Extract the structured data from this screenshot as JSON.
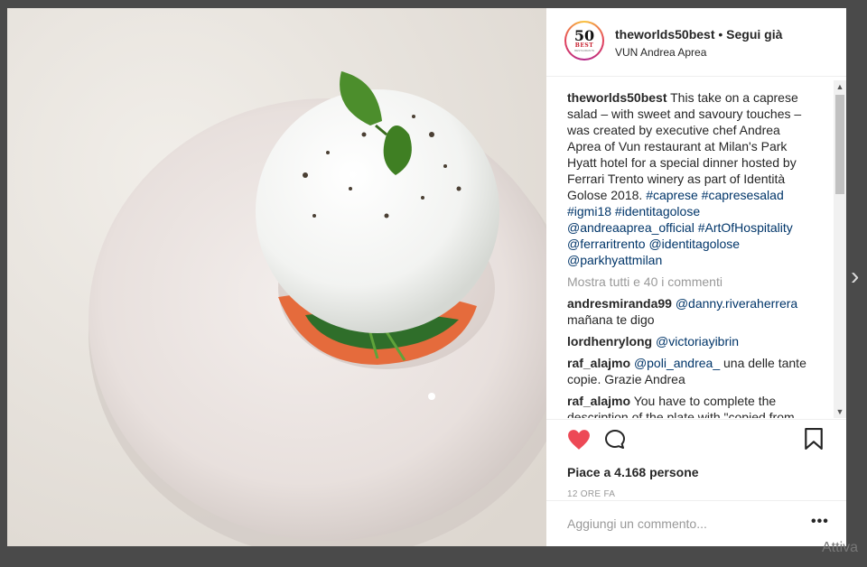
{
  "post": {
    "avatar": {
      "num": "50",
      "best": "BEST",
      "sub": "RESTAURANTS"
    },
    "username": "theworlds50best",
    "separator": " • ",
    "follow_label": "Segui già",
    "location": "VUN Andrea Aprea",
    "caption": {
      "username": "theworlds50best",
      "text": "This take on a caprese salad – with sweet and savoury touches – was created by executive chef Andrea Aprea of Vun restaurant at Milan's Park Hyatt hotel for a special dinner hosted by Ferrari Trento winery as part of Identità Golose 2018.",
      "tags": "#caprese #capresesalad #igmi18 #identitagolose @andreaaprea_official #ArtOfHospitality @ferraritrento @identitagolose @parkhyattmilan"
    },
    "view_all": "Mostra tutti e 40 i commenti",
    "comments": [
      {
        "user": "andresmiranda99",
        "mention": "@danny.riveraherrera",
        "text": "mañana te digo"
      },
      {
        "user": "lordhenrylong",
        "mention": "@victoriayibrin",
        "text": ""
      },
      {
        "user": "raf_alajmo",
        "mention": "@poli_andrea_",
        "text": "una delle tante copie. Grazie Andrea"
      },
      {
        "user": "raf_alajmo",
        "mention": "",
        "text": "You have to complete the description of the plate with \"copied from"
      }
    ],
    "likes": "Piace a 4.168 persone",
    "time": "12 ORE FA",
    "add_comment_placeholder": "Aggiungi un commento...",
    "more": "•••"
  },
  "scroll": {
    "up": "▲",
    "down": "▼"
  },
  "nav": {
    "next": "›"
  },
  "watermark": "Attiva",
  "colors": {
    "heart": "#ed4956",
    "link": "#003569",
    "muted": "#999999"
  },
  "icons": [
    "heart-icon",
    "comment-icon",
    "bookmark-icon",
    "more-icon",
    "chevron-right-icon"
  ]
}
